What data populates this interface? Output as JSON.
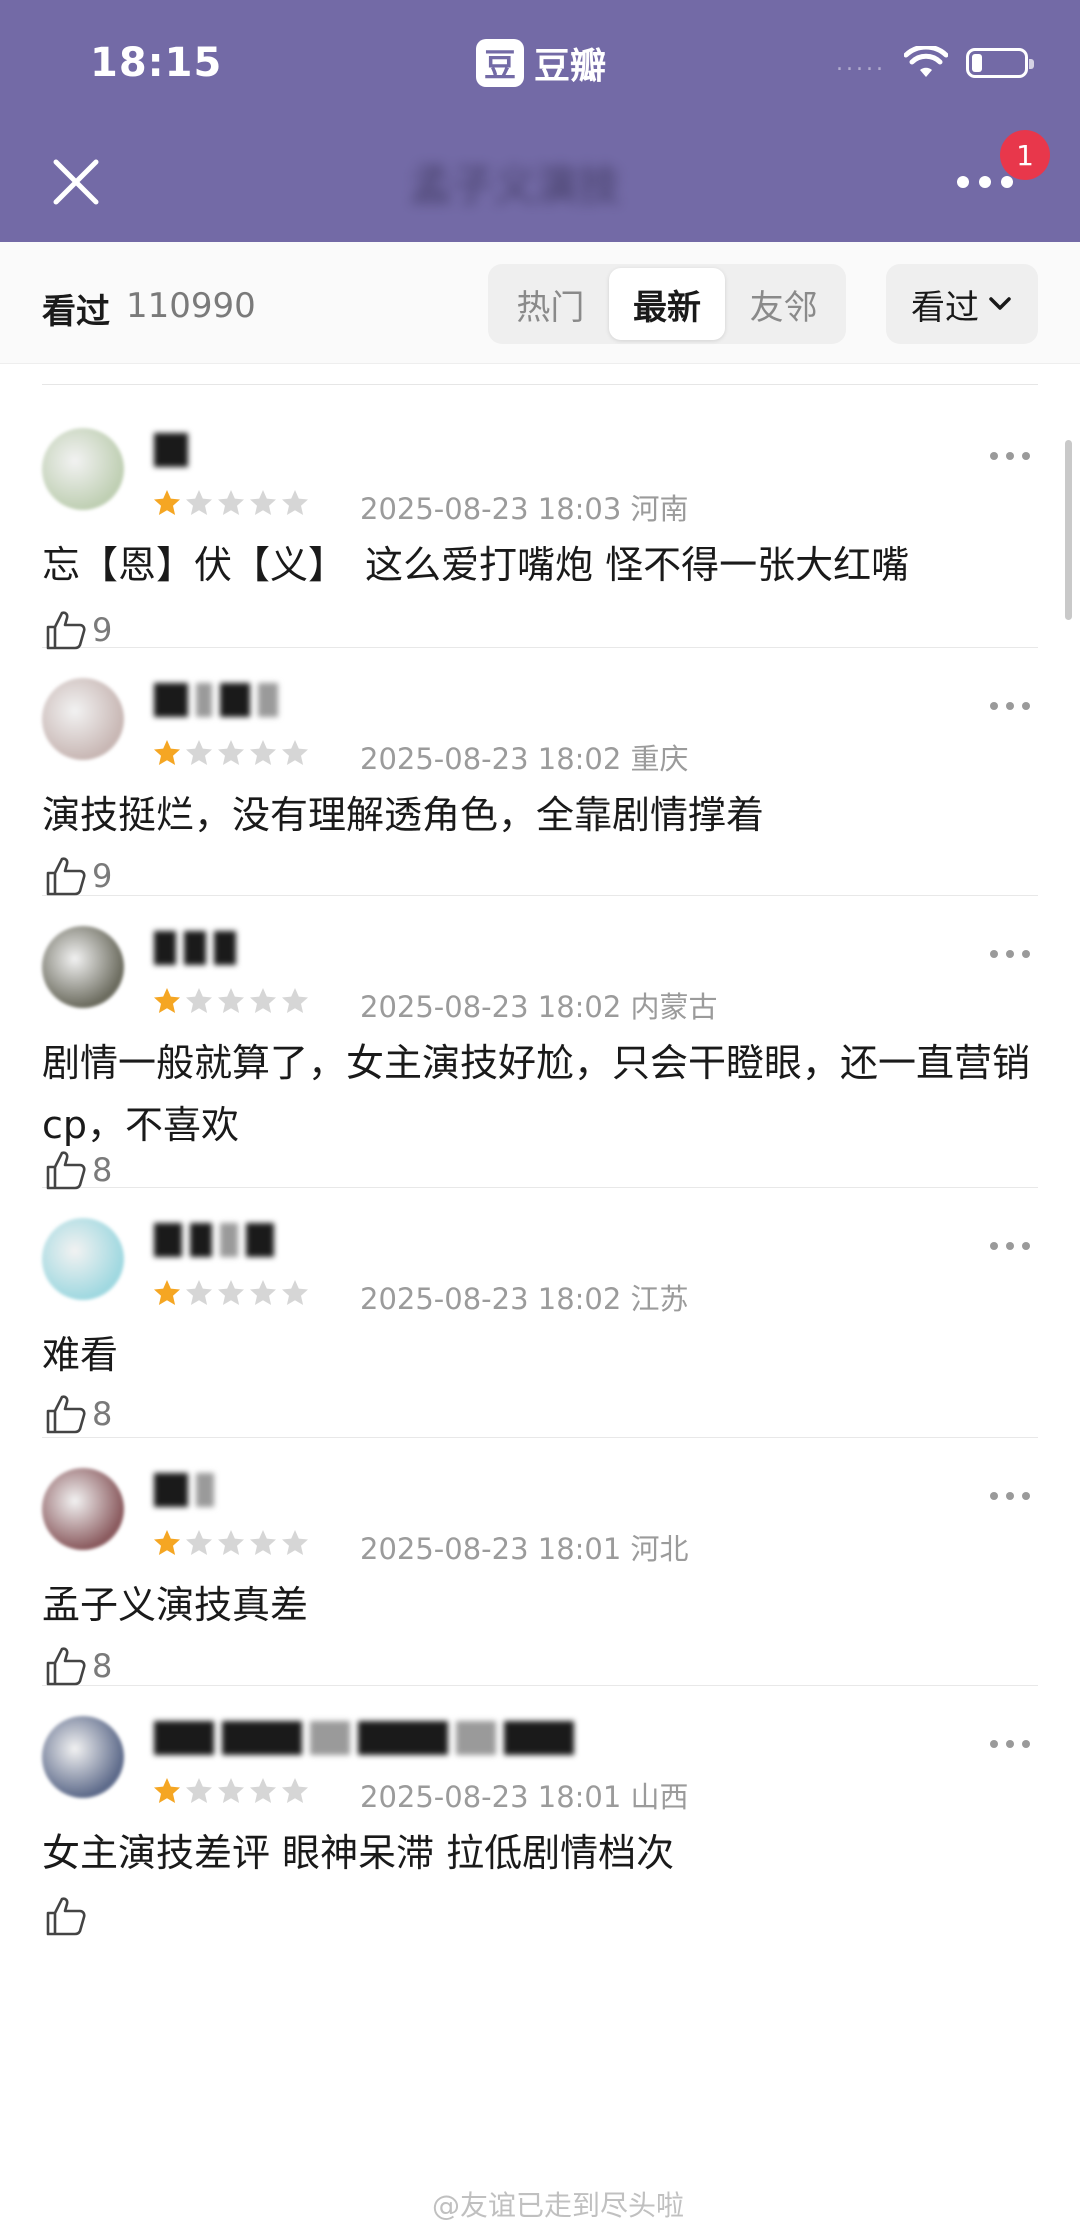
{
  "status_bar": {
    "time": "18:15",
    "app_logo_char": "豆",
    "app_name": "豆瓣",
    "signal_text": "....."
  },
  "nav": {
    "title": "孟子义演技",
    "notification_count": "1"
  },
  "filter": {
    "label": "看过",
    "count": "110990",
    "tabs": [
      "热门",
      "最新",
      "友邻"
    ],
    "active_tab": "最新",
    "sort_label": "看过"
  },
  "reviews": [
    {
      "rating": 1,
      "date": "2025-08-23 18:03",
      "location": "河南",
      "content": "忘【恩】伏【义】　这么爱打嘴炮  怪不得一张大红嘴",
      "likes": "9",
      "avatar_color": "#bfcfb3"
    },
    {
      "rating": 1,
      "date": "2025-08-23 18:02",
      "location": "重庆",
      "content": "演技挺烂，没有理解透角色，全靠剧情撑着",
      "likes": "9",
      "avatar_color": "#c8b7b4"
    },
    {
      "rating": 1,
      "date": "2025-08-23 18:02",
      "location": "内蒙古",
      "content": "剧情一般就算了，女主演技好尬，只会干瞪眼，还一直营销 cp，不喜欢",
      "likes": "8",
      "avatar_color": "#6b6b5e"
    },
    {
      "rating": 1,
      "date": "2025-08-23 18:02",
      "location": "江苏",
      "content": "难看",
      "likes": "8",
      "avatar_color": "#9fd8e0"
    },
    {
      "rating": 1,
      "date": "2025-08-23 18:01",
      "location": "河北",
      "content": "孟子义演技真差",
      "likes": "8",
      "avatar_color": "#8a5a5e"
    },
    {
      "rating": 1,
      "date": "2025-08-23 18:01",
      "location": "山西",
      "content": "女主演技差评 眼神呆滞 拉低剧情档次",
      "likes": "",
      "avatar_color": "#5d6a8a"
    }
  ],
  "watermark": "@友谊已走到尽头啦",
  "colors": {
    "header": "#736aa6",
    "star_on": "#f5a623",
    "star_off": "#d6d6d6",
    "badge": "#e8374b"
  }
}
